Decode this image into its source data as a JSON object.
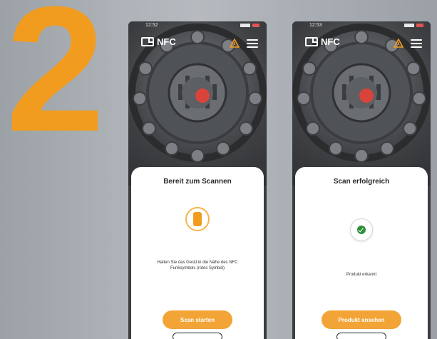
{
  "step": {
    "number": "2"
  },
  "colors": {
    "accent": "#f29c1f",
    "success": "#2f8f3a",
    "card": "#ffffff"
  },
  "screens": [
    {
      "status_time": "12:52",
      "app_title": "NFC",
      "card_title": "Bereit zum Scannen",
      "icon": "phone-nfc-icon",
      "message": "Halten Sie das Gerät in die Nähe des NFC Funksymbols (rotes Symbol)",
      "primary_button": "Scan starten"
    },
    {
      "status_time": "12:53",
      "app_title": "NFC",
      "card_title": "Scan erfolgreich",
      "icon": "success-check-icon",
      "message": "Produkt erkannt",
      "primary_button": "Produkt ansehen"
    }
  ]
}
